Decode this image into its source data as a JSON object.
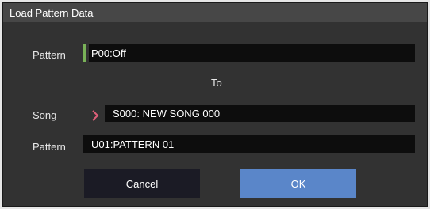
{
  "dialog": {
    "title": "Load Pattern Data"
  },
  "source": {
    "label": "Pattern",
    "value": "P00:Off"
  },
  "to_label": "To",
  "destination": {
    "song_label": "Song",
    "song_value": "S000: NEW SONG 000",
    "pattern_label": "Pattern",
    "pattern_value": "U01:PATTERN 01"
  },
  "buttons": {
    "cancel": "Cancel",
    "ok": "OK"
  },
  "colors": {
    "marker": "#79b258",
    "chevron": "#e0607a",
    "ok_button": "#5a86c9",
    "cancel_button": "#1b1b25"
  },
  "icons": {
    "song_picker": "chevron-right-icon"
  }
}
